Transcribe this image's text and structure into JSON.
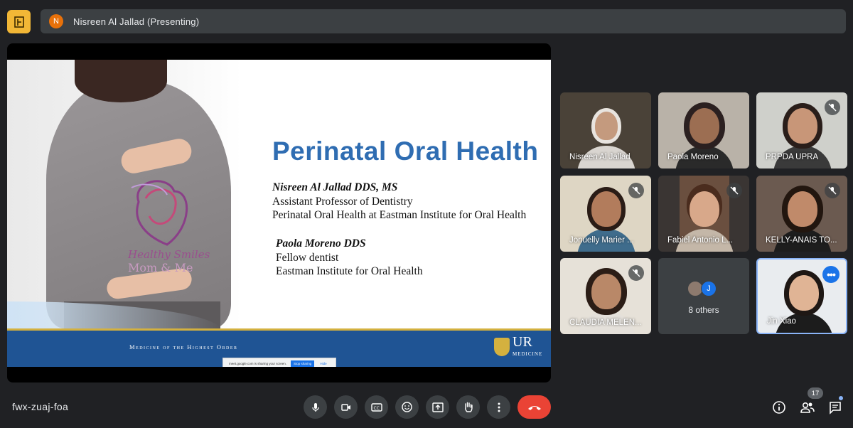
{
  "header": {
    "presenter_initial": "N",
    "presenter_label": "Nisreen Al Jallad (Presenting)"
  },
  "slide": {
    "title": "Perinatal Oral Health",
    "logo_line1": "Healthy Smiles",
    "logo_line2": "Mom & Me",
    "presenter1": {
      "name": "Nisreen Al Jallad DDS, MS",
      "line1": "Assistant Professor of Dentistry",
      "line2": "Perinatal Oral Health at Eastman Institute for Oral Health"
    },
    "presenter2": {
      "name": "Paola Moreno DDS",
      "line1": "Fellow dentist",
      "line2": "Eastman Institute for Oral Health"
    },
    "motto": "Medicine of the Highest Order",
    "ur_big": "UR",
    "ur_small": "MEDICINE",
    "share_notice": {
      "text": "meet.google.com is sharing your screen.",
      "stop": "Stop sharing",
      "hide": "Hide"
    }
  },
  "participants": [
    {
      "name": "Nisreen Al Jallad",
      "muted": false
    },
    {
      "name": "Paola Moreno",
      "muted": false
    },
    {
      "name": "PRPDA UPRA",
      "muted": true
    },
    {
      "name": "Jonuelly Marier ...",
      "muted": true
    },
    {
      "name": "Fabiel Antonio L...",
      "muted": true
    },
    {
      "name": "KELLY-ANAIS TO...",
      "muted": true
    },
    {
      "name": "CLAUDIA MELEN...",
      "muted": true
    },
    {
      "name": "Jin Xiao",
      "muted": false
    }
  ],
  "others": {
    "avatar_initial": "J",
    "label": "8 others"
  },
  "footer": {
    "meeting_code": "fwx-zuaj-foa",
    "people_count": "17"
  },
  "colors": {
    "accent": "#1a73e8",
    "end_call": "#ea4335",
    "slide_title": "#2f6db2",
    "footer_band": "#1f5494"
  }
}
